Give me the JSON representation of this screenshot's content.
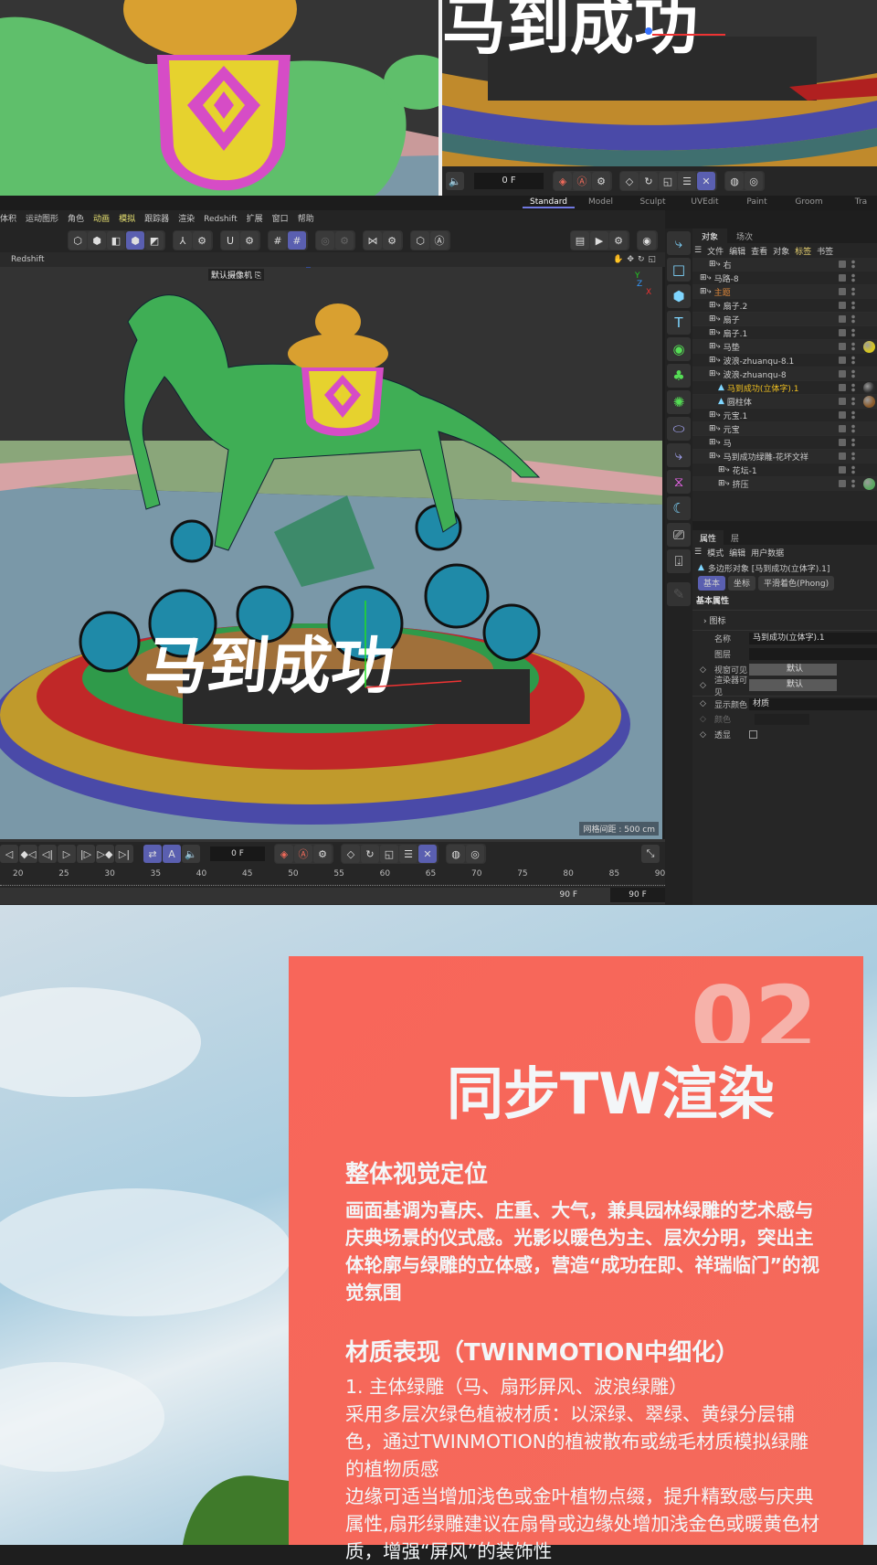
{
  "top": {
    "frame_value": "0 F",
    "layout_tabs": [
      "Standard",
      "Model",
      "Sculpt",
      "UVEdit",
      "Paint",
      "Groom",
      "Tra"
    ]
  },
  "menu": [
    "体积",
    "运动图形",
    "角色",
    "动画",
    "模拟",
    "跟踪器",
    "渲染",
    "Redshift",
    "扩展",
    "窗口",
    "帮助"
  ],
  "viewport": {
    "menu_label": "Redshift",
    "camera_label": "默认摄像机",
    "grid_spacing": "网格间距 : 500 cm",
    "axis": {
      "y": "Y",
      "z": "Z",
      "x": "X"
    },
    "scene_text": "马到成功"
  },
  "timeline": {
    "frame_value": "0 F",
    "ticks": [
      "20",
      "25",
      "30",
      "35",
      "40",
      "45",
      "50",
      "55",
      "60",
      "65",
      "70",
      "75",
      "80",
      "85",
      "90"
    ],
    "end_frame_a": "90 F",
    "end_frame_b": "90 F"
  },
  "object_manager": {
    "tabs": [
      "对象",
      "场次"
    ],
    "menu": [
      "文件",
      "编辑",
      "查看",
      "对象",
      "标签",
      "书签"
    ],
    "items": [
      {
        "label": "右",
        "indent": 1,
        "type": "null"
      },
      {
        "label": "马路-8",
        "indent": 0,
        "type": "null"
      },
      {
        "label": "主题",
        "indent": 0,
        "type": "null",
        "color": "#e0883a"
      },
      {
        "label": "扇子.2",
        "indent": 1,
        "type": "null"
      },
      {
        "label": "扇子",
        "indent": 1,
        "type": "null"
      },
      {
        "label": "扇子.1",
        "indent": 1,
        "type": "null"
      },
      {
        "label": "马垫",
        "indent": 1,
        "type": "null",
        "material": "#d8c820"
      },
      {
        "label": "波浪-zhuanqu-8.1",
        "indent": 1,
        "type": "null"
      },
      {
        "label": "波浪-zhuanqu-8",
        "indent": 1,
        "type": "null"
      },
      {
        "label": "马到成功(立体字).1",
        "indent": 2,
        "type": "poly",
        "color": "#f0c020",
        "material": "#2a2a2a"
      },
      {
        "label": "圆柱体",
        "indent": 2,
        "type": "poly",
        "material": "#8a5a2a"
      },
      {
        "label": "元宝.1",
        "indent": 1,
        "type": "null"
      },
      {
        "label": "元宝",
        "indent": 1,
        "type": "null"
      },
      {
        "label": "马",
        "indent": 1,
        "type": "null"
      },
      {
        "label": "马到成功绿雕-花坏文祥",
        "indent": 1,
        "type": "null"
      },
      {
        "label": "花坛-1",
        "indent": 2,
        "type": "null"
      },
      {
        "label": "挤压",
        "indent": 2,
        "type": "null",
        "material": "#5aa860"
      }
    ]
  },
  "attributes": {
    "tabs": [
      "属性",
      "层"
    ],
    "menu": [
      "模式",
      "编辑",
      "用户数据"
    ],
    "object_title": "多边形对象 [马到成功(立体字).1]",
    "subtabs": [
      "基本",
      "坐标",
      "平滑着色(Phong)"
    ],
    "section": "基本属性",
    "icon_row": "图标",
    "fields": [
      {
        "label": "名称",
        "value": "马到成功(立体字).1"
      },
      {
        "label": "图层",
        "value": ""
      },
      {
        "label": "视窗可见",
        "value": "默认"
      },
      {
        "label": "渲染器可见",
        "value": "默认"
      },
      {
        "label": "显示颜色",
        "value": "材质"
      },
      {
        "label": "颜色",
        "value": ""
      },
      {
        "label": "透显",
        "value": ""
      }
    ]
  },
  "panel": {
    "number": "02",
    "title": "同步TW渲染",
    "section1_heading": "整体视觉定位",
    "section1_body": "画面基调为喜庆、庄重、大气，兼具园林绿雕的艺术感与庆典场景的仪式感。光影以暖色为主、层次分明，突出主体轮廓与绿雕的立体感，营造“成功在即、祥瑞临门”的视觉氛围",
    "section2_heading": "材质表现（TWINMOTION中细化）",
    "section2_lines": [
      "1. 主体绿雕（马、扇形屏风、波浪绿雕）",
      "采用多层次绿色植被材质：以深绿、翠绿、黄绿分层铺色，通过TWINMOTION的植被散布或绒毛材质模拟绿雕的植物质感",
      "边缘可适当增加浅色或金叶植物点缀，提升精致感与庆典属性,扇形绿雕建议在扇骨或边缘处增加浅金色或暖黄色材质，增强“屏风”的装饰性"
    ],
    "bg_color": "#f7665a"
  }
}
